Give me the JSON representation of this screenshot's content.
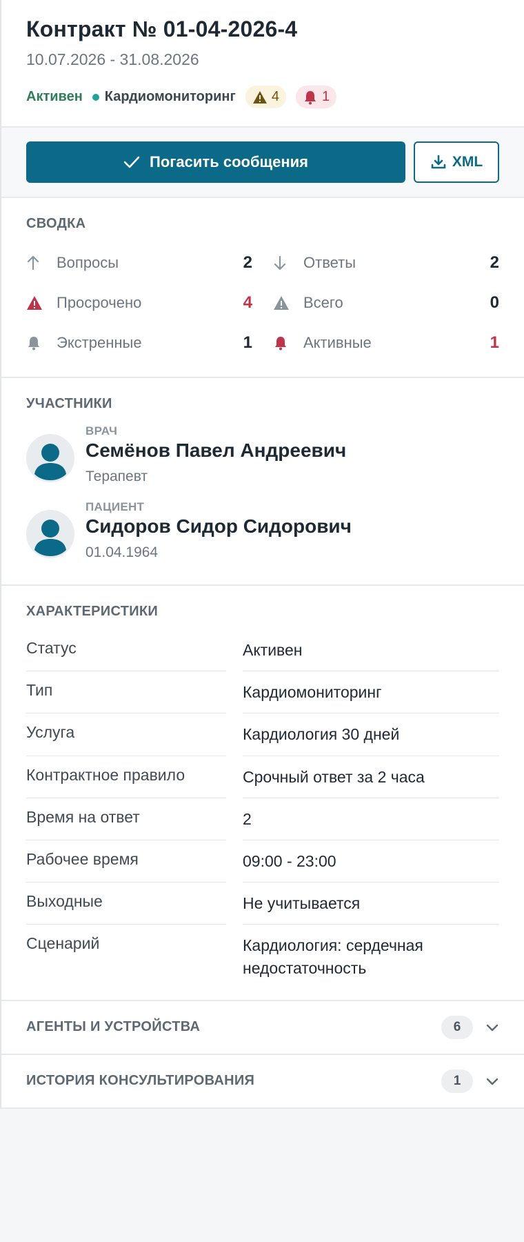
{
  "header": {
    "title": "Контракт № 01-04-2026-4",
    "dates": "10.07.2026 - 31.08.2026",
    "status": "Активен",
    "type": "Кардиомониторинг",
    "warnings_count": "4",
    "alarms_count": "1"
  },
  "actions": {
    "primary_label": "Погасить сообщения",
    "xml_label": "XML"
  },
  "summary": {
    "title": "СВОДКА",
    "items": [
      {
        "label": "Вопросы",
        "value": "2",
        "icon": "arrow-up-icon"
      },
      {
        "label": "Ответы",
        "value": "2",
        "icon": "arrow-down-icon"
      },
      {
        "label": "Просрочено",
        "value": "4",
        "icon": "warning-red-icon"
      },
      {
        "label": "Всего",
        "value": "0",
        "icon": "warning-gray-icon"
      },
      {
        "label": "Экстренные",
        "value": "1",
        "icon": "bell-gray-icon"
      },
      {
        "label": "Активные",
        "value": "1",
        "icon": "bell-red-icon"
      }
    ]
  },
  "participants": {
    "title": "УЧАСТНИКИ",
    "doctor": {
      "role": "ВРАЧ",
      "name": "Семёнов Павел Андреевич",
      "sub": "Терапевт"
    },
    "patient": {
      "role": "ПАЦИЕНТ",
      "name": "Сидоров Сидор Сидорович",
      "sub": "01.04.1964"
    }
  },
  "characteristics": {
    "title": "ХАРАКТЕРИСТИКИ",
    "rows": [
      {
        "key": "Статус",
        "value": "Активен"
      },
      {
        "key": "Тип",
        "value": "Кардиомониторинг"
      },
      {
        "key": "Услуга",
        "value": "Кардиология 30 дней"
      },
      {
        "key": "Контрактное правило",
        "value": "Срочный ответ за 2 часа"
      },
      {
        "key": "Время на ответ",
        "value": "2"
      },
      {
        "key": "Рабочее время",
        "value": "09:00 - 23:00"
      },
      {
        "key": "Выходные",
        "value": "Не учитывается"
      },
      {
        "key": "Сценарий",
        "value": "Кардиология: сердечная недостаточность"
      }
    ]
  },
  "collapsibles": {
    "agents": {
      "title": "АГЕНТЫ И УСТРОЙСТВА",
      "count": "6"
    },
    "history": {
      "title": "ИСТОРИЯ КОНСУЛЬТИРОВАНИЯ",
      "count": "1"
    }
  },
  "colors": {
    "primary": "#0a6a88",
    "active_green": "#2f7d59",
    "alert_red": "#c0344a",
    "type_dot": "#22a39a"
  }
}
